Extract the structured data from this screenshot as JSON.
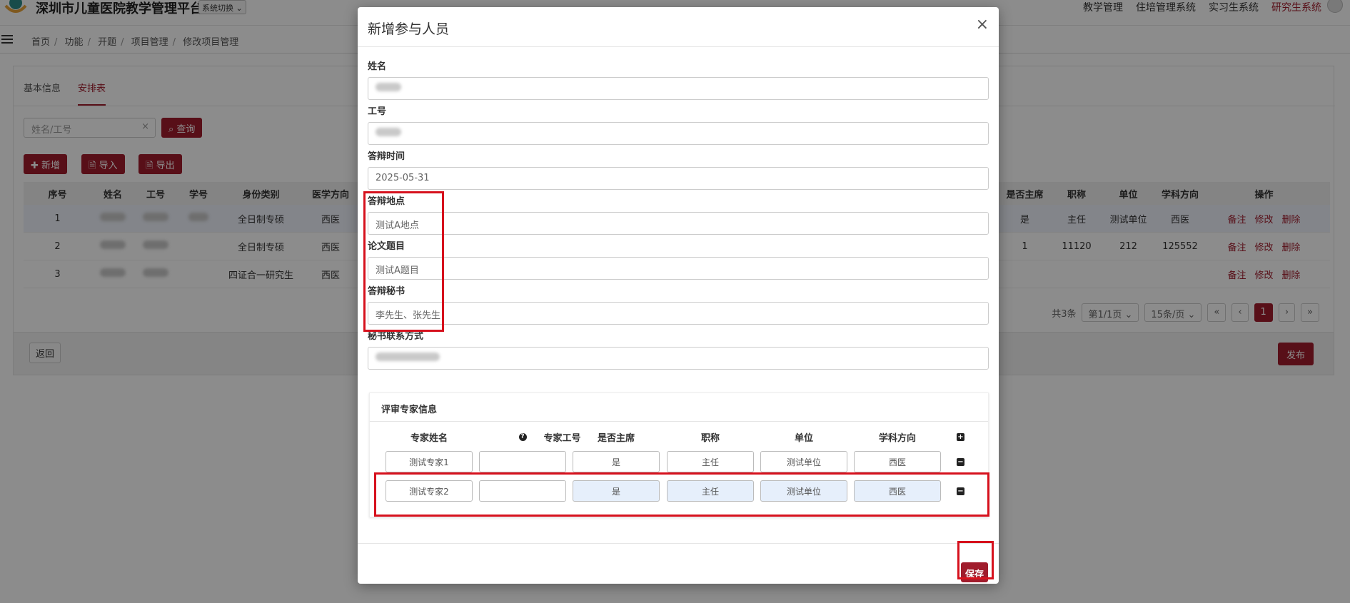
{
  "header": {
    "brand": "深圳市儿童医院教学管理平台",
    "system_switch": "系统切换 ⌄",
    "nav": [
      "教学管理",
      "住培管理系统",
      "实习生系统",
      "研究生系统"
    ]
  },
  "breadcrumb": [
    "首页",
    "功能",
    "开题",
    "项目管理",
    "修改项目管理"
  ],
  "tabs": [
    "基本信息",
    "安排表"
  ],
  "search": {
    "placeholder": "姓名/工号",
    "query_label": "查询"
  },
  "actions": {
    "add": "新增",
    "import": "导入",
    "export": "导出"
  },
  "table": {
    "headers_left": [
      "序号",
      "姓名",
      "工号",
      "学号",
      "身份类别",
      "医学方向"
    ],
    "headers_right": [
      "是否主席",
      "职称",
      "单位",
      "学科方向",
      "操作"
    ],
    "rows": [
      {
        "no": "1",
        "type": "全日制专硕",
        "dir": "西医",
        "chair": "是",
        "title": "主任",
        "unit": "测试单位",
        "subject": "西医"
      },
      {
        "no": "2",
        "type": "全日制专硕",
        "dir": "西医",
        "chair": "1",
        "title": "11120",
        "unit": "212",
        "subject": "125552"
      },
      {
        "no": "3",
        "type": "四证合一研究生",
        "dir": "西医",
        "chair": "",
        "title": "",
        "unit": "",
        "subject": ""
      }
    ],
    "ops": [
      "备注",
      "修改",
      "删除"
    ]
  },
  "pager": {
    "total": "共3条",
    "page": "第1/1页 ⌄",
    "size": "15条/页 ⌄",
    "first": "«",
    "prev": "‹",
    "current": "1",
    "next": "›",
    "last": "»"
  },
  "footer": {
    "back": "返回",
    "publish": "发布"
  },
  "modal": {
    "title": "新增参与人员",
    "close": "×",
    "fields": {
      "name_label": "姓名",
      "id_label": "工号",
      "date_label": "答辩时间",
      "date_value": "2025-05-31",
      "place_label": "答辩地点",
      "place_value": "测试A地点",
      "topic_label": "论文题目",
      "topic_value": "测试A题目",
      "secretary_label": "答辩秘书",
      "secretary_value": "李先生、张先生",
      "contact_label": "秘书联系方式"
    },
    "experts": {
      "title": "评审专家信息",
      "headers": [
        "专家姓名",
        "专家工号",
        "是否主席",
        "职称",
        "单位",
        "学科方向"
      ],
      "rows": [
        {
          "name": "测试专家1",
          "id": "",
          "chair": "是",
          "title": "主任",
          "unit": "测试单位",
          "subject": "西医"
        },
        {
          "name": "测试专家2",
          "id": "",
          "chair": "是",
          "title": "主任",
          "unit": "测试单位",
          "subject": "西医"
        }
      ]
    },
    "save": "保存"
  }
}
